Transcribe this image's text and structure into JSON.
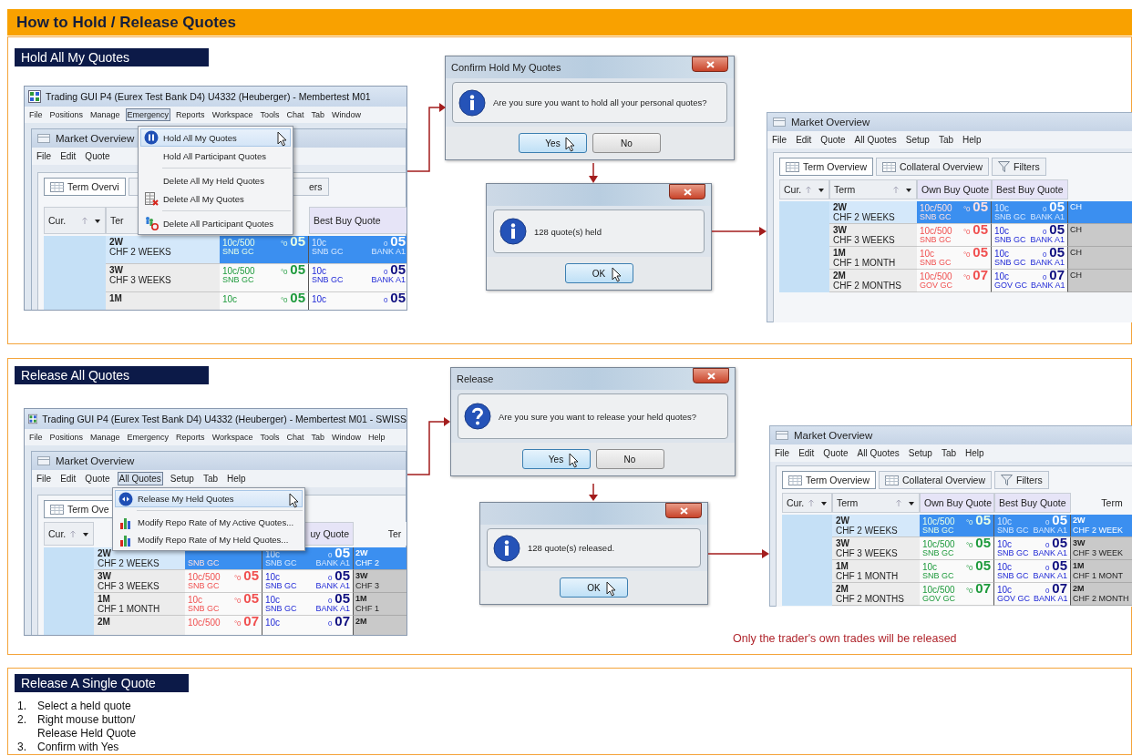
{
  "header": {
    "title": "How to Hold / Release Quotes"
  },
  "sections": [
    {
      "kind": "hold",
      "title": "Hold All My Quotes",
      "app": {
        "title": "Trading GUI P4 (Eurex Test Bank D4) U4332 (Heuberger) - Membertest M01",
        "menu": [
          {
            "label": "File",
            "selected": false
          },
          {
            "label": "Positions",
            "selected": false
          },
          {
            "label": "Manage",
            "selected": false
          },
          {
            "label": "Emergency",
            "selected": true
          },
          {
            "label": "Reports",
            "selected": false
          },
          {
            "label": "Workspace",
            "selected": false
          },
          {
            "label": "Tools",
            "selected": false
          },
          {
            "label": "Chat",
            "selected": false
          },
          {
            "label": "Tab",
            "selected": false
          },
          {
            "label": "Window",
            "selected": false
          }
        ],
        "market": {
          "title": "Market Overview",
          "menu": [
            {
              "label": "File",
              "selected": false
            },
            {
              "label": "Edit",
              "selected": false
            },
            {
              "label": "Quote",
              "selected": false
            }
          ],
          "tabs": [
            {
              "label": "Term Overvi",
              "kind": "view",
              "selected": true
            },
            {
              "label": "ers",
              "kind": "partial",
              "selected": false
            }
          ],
          "header": {
            "cur": "Cur.",
            "term": "Ter",
            "best": "Best Buy Quote"
          },
          "rows": [
            {
              "term": "2W",
              "name": "CHF 2 WEEKS",
              "selected": true,
              "own": {
                "size": "10c/500",
                "source": "SNB GC",
                "mark": "°0",
                "price": "05",
                "held": false
              },
              "best": {
                "size": "10c",
                "source": "SNB GC",
                "mark": "0",
                "price": "05",
                "bank": "BANK A1"
              }
            },
            {
              "term": "3W",
              "name": "CHF 3 WEEKS",
              "selected": false,
              "own": {
                "size": "10c/500",
                "source": "SNB GC",
                "mark": "°0",
                "price": "05",
                "held": false
              },
              "best": {
                "size": "10c",
                "source": "SNB GC",
                "mark": "0",
                "price": "05",
                "bank": "BANK A1"
              }
            },
            {
              "term": "1M",
              "selected": false,
              "own": {
                "size": "10c",
                "mark": "°0",
                "price": "05",
                "held": false
              },
              "best": {
                "size": "10c",
                "mark": "0",
                "price": "05"
              }
            }
          ]
        },
        "popup": {
          "items": [
            {
              "kind": "hold",
              "label": "Hold All My Quotes",
              "selected": true
            },
            {
              "kind": "item",
              "label": "Hold All Participant Quotes",
              "selected": false
            },
            {
              "kind": "separator"
            },
            {
              "kind": "item",
              "label": "Delete All My Held Quotes",
              "selected": false
            },
            {
              "kind": "delete-mine",
              "label": "Delete All My Quotes",
              "selected": false
            },
            {
              "kind": "separator"
            },
            {
              "kind": "delete-participants",
              "label": "Delete All Participant Quotes",
              "selected": false
            }
          ]
        }
      },
      "confirm": {
        "title": "Confirm Hold My Quotes",
        "kind": "info",
        "message": "Are you sure you want to hold all your personal quotes?",
        "buttons": [
          {
            "label": "Yes",
            "selected": true
          },
          {
            "label": "No",
            "selected": false
          }
        ]
      },
      "result": {
        "kind": "info",
        "message": "128 quote(s) held",
        "buttons": [
          {
            "label": "OK",
            "selected": true
          }
        ]
      },
      "market": {
        "title": "Market Overview",
        "menu": [
          {
            "label": "File",
            "selected": false
          },
          {
            "label": "Edit",
            "selected": false
          },
          {
            "label": "Quote",
            "selected": false
          },
          {
            "label": "All Quotes",
            "selected": false
          },
          {
            "label": "Setup",
            "selected": false
          },
          {
            "label": "Tab",
            "selected": false
          },
          {
            "label": "Help",
            "selected": false
          }
        ],
        "tabs": [
          {
            "label": "Term Overview",
            "kind": "view",
            "selected": true
          },
          {
            "label": "Collateral Overview",
            "kind": "view",
            "selected": false
          },
          {
            "label": "Filters",
            "kind": "filter",
            "selected": false
          }
        ],
        "header": {
          "cur": "Cur.",
          "term": "Term",
          "own": "Own Buy Quote",
          "best": "Best Buy Quote"
        },
        "rows": [
          {
            "term": "2W",
            "name": "CHF 2 WEEKS",
            "selected": true,
            "own": {
              "size": "10c/500",
              "source": "SNB GC",
              "mark": "°0",
              "price": "05",
              "held": true
            },
            "best": {
              "size": "10c",
              "source": "SNB GC",
              "mark": "0",
              "price": "05",
              "bank": "BANK A1"
            },
            "extra": {
              "name": "CH"
            }
          },
          {
            "term": "3W",
            "name": "CHF 3 WEEKS",
            "selected": false,
            "own": {
              "size": "10c/500",
              "source": "SNB GC",
              "mark": "°0",
              "price": "05",
              "held": true
            },
            "best": {
              "size": "10c",
              "source": "SNB GC",
              "mark": "0",
              "price": "05",
              "bank": "BANK A1"
            },
            "extra": {
              "name": "CH"
            }
          },
          {
            "term": "1M",
            "name": "CHF 1 MONTH",
            "selected": false,
            "own": {
              "size": "10c",
              "source": "SNB GC",
              "mark": "°0",
              "price": "05",
              "held": true
            },
            "best": {
              "size": "10c",
              "source": "SNB GC",
              "mark": "0",
              "price": "05",
              "bank": "BANK A1"
            },
            "extra": {
              "name": "CH"
            }
          },
          {
            "term": "2M",
            "name": "CHF 2 MONTHS",
            "selected": false,
            "own": {
              "size": "10c/500",
              "source": "GOV GC",
              "mark": "°0",
              "price": "07",
              "held": true
            },
            "best": {
              "size": "10c",
              "source": "GOV GC",
              "mark": "0",
              "price": "07",
              "bank": "BANK A1"
            },
            "extra": {
              "name": "CH"
            }
          }
        ]
      }
    },
    {
      "kind": "release",
      "title": "Release All Quotes",
      "app": {
        "title": "Trading GUI P4 (Eurex Test Bank D4) U4332 (Heuberger) - Membertest M01 - SWISS",
        "menu": [
          {
            "label": "File",
            "selected": false
          },
          {
            "label": "Positions",
            "selected": false
          },
          {
            "label": "Manage",
            "selected": false
          },
          {
            "label": "Emergency",
            "selected": false
          },
          {
            "label": "Reports",
            "selected": false
          },
          {
            "label": "Workspace",
            "selected": false
          },
          {
            "label": "Tools",
            "selected": false
          },
          {
            "label": "Chat",
            "selected": false
          },
          {
            "label": "Tab",
            "selected": false
          },
          {
            "label": "Window",
            "selected": false
          },
          {
            "label": "Help",
            "selected": false
          }
        ],
        "market": {
          "title": "Market Overview",
          "menu": [
            {
              "label": "File",
              "selected": false
            },
            {
              "label": "Edit",
              "selected": false
            },
            {
              "label": "Quote",
              "selected": false
            },
            {
              "label": "All Quotes",
              "selected": true
            },
            {
              "label": "Setup",
              "selected": false
            },
            {
              "label": "Tab",
              "selected": false
            },
            {
              "label": "Help",
              "selected": false
            }
          ],
          "tabs": [
            {
              "label": "Term Ove",
              "kind": "view",
              "selected": true
            }
          ],
          "header": {
            "cur": "Cur.",
            "best": "uy Quote",
            "extra": "Ter"
          },
          "rows": [
            {
              "term": "2W",
              "name": "CHF 2 WEEKS",
              "selected": true,
              "own": {
                "source": "SNB GC",
                "held": true
              },
              "best": {
                "size": "10c",
                "source": "SNB GC",
                "mark": "0",
                "price": "05",
                "bank": "BANK A1"
              },
              "extra": {
                "term": "2W",
                "name": "CHF 2"
              }
            },
            {
              "term": "3W",
              "name": "CHF 3 WEEKS",
              "selected": false,
              "own": {
                "size": "10c/500",
                "source": "SNB GC",
                "mark": "°0",
                "price": "05",
                "held": true
              },
              "best": {
                "size": "10c",
                "source": "SNB GC",
                "mark": "0",
                "price": "05",
                "bank": "BANK A1"
              },
              "extra": {
                "term": "3W",
                "name": "CHF 3"
              }
            },
            {
              "term": "1M",
              "name": "CHF 1 MONTH",
              "selected": false,
              "own": {
                "size": "10c",
                "source": "SNB GC",
                "mark": "°0",
                "price": "05",
                "held": true
              },
              "best": {
                "size": "10c",
                "source": "SNB GC",
                "mark": "0",
                "price": "05",
                "bank": "BANK A1"
              },
              "extra": {
                "term": "1M",
                "name": "CHF 1"
              }
            },
            {
              "term": "2M",
              "selected": false,
              "own": {
                "size": "10c/500",
                "mark": "°0",
                "price": "07",
                "held": true
              },
              "best": {
                "size": "10c",
                "mark": "0",
                "price": "07"
              },
              "extra": {
                "term": "2M"
              }
            }
          ]
        },
        "popup": {
          "items": [
            {
              "kind": "release",
              "label": "Release My Held Quotes",
              "selected": true
            },
            {
              "kind": "separator"
            },
            {
              "kind": "repo-rate",
              "label": "Modify Repo Rate of My Active Quotes...",
              "selected": false
            },
            {
              "kind": "repo-rate",
              "label": "Modify Repo Rate of My Held Quotes...",
              "selected": false
            }
          ]
        }
      },
      "confirm": {
        "title": "Release",
        "kind": "question",
        "message": "Are you sure you want to release your held quotes?",
        "buttons": [
          {
            "label": "Yes",
            "selected": true
          },
          {
            "label": "No",
            "selected": false
          }
        ]
      },
      "result": {
        "kind": "info",
        "message": "128 quote(s) released.",
        "buttons": [
          {
            "label": "OK",
            "selected": true
          }
        ]
      },
      "market": {
        "title": "Market Overview",
        "menu": [
          {
            "label": "File",
            "selected": false
          },
          {
            "label": "Edit",
            "selected": false
          },
          {
            "label": "Quote",
            "selected": false
          },
          {
            "label": "All Quotes",
            "selected": false
          },
          {
            "label": "Setup",
            "selected": false
          },
          {
            "label": "Tab",
            "selected": false
          },
          {
            "label": "Help",
            "selected": false
          }
        ],
        "tabs": [
          {
            "label": "Term Overview",
            "kind": "view",
            "selected": true
          },
          {
            "label": "Collateral Overview",
            "kind": "view",
            "selected": false
          },
          {
            "label": "Filters",
            "kind": "filter",
            "selected": false
          }
        ],
        "header": {
          "cur": "Cur.",
          "term": "Term",
          "own": "Own Buy Quote",
          "best": "Best Buy Quote",
          "extra": "Term"
        },
        "rows": [
          {
            "term": "2W",
            "name": "CHF 2 WEEKS",
            "selected": true,
            "own": {
              "size": "10c/500",
              "source": "SNB GC",
              "mark": "°0",
              "price": "05",
              "held": false
            },
            "best": {
              "size": "10c",
              "source": "SNB GC",
              "mark": "0",
              "price": "05",
              "bank": "BANK A1"
            },
            "extra": {
              "term": "2W",
              "name": "CHF 2 WEEK"
            }
          },
          {
            "term": "3W",
            "name": "CHF 3 WEEKS",
            "selected": false,
            "own": {
              "size": "10c/500",
              "source": "SNB GC",
              "mark": "°0",
              "price": "05",
              "held": false
            },
            "best": {
              "size": "10c",
              "source": "SNB GC",
              "mark": "0",
              "price": "05",
              "bank": "BANK A1"
            },
            "extra": {
              "term": "3W",
              "name": "CHF 3 WEEK"
            }
          },
          {
            "term": "1M",
            "name": "CHF 1 MONTH",
            "selected": false,
            "own": {
              "size": "10c",
              "source": "SNB GC",
              "mark": "°0",
              "price": "05",
              "held": false
            },
            "best": {
              "size": "10c",
              "source": "SNB GC",
              "mark": "0",
              "price": "05",
              "bank": "BANK A1"
            },
            "extra": {
              "term": "1M",
              "name": "CHF 1 MONT"
            }
          },
          {
            "term": "2M",
            "name": "CHF 2 MONTHS",
            "selected": false,
            "own": {
              "size": "10c/500",
              "source": "GOV GC",
              "mark": "°0",
              "price": "07",
              "held": false
            },
            "best": {
              "size": "10c",
              "source": "GOV GC",
              "mark": "0",
              "price": "07",
              "bank": "BANK A1"
            },
            "extra": {
              "term": "2M",
              "name": "CHF 2 MONTH"
            }
          }
        ]
      },
      "note": "Only the trader's own trades will be released"
    }
  ],
  "single": {
    "title": "Release A Single Quote",
    "steps": [
      {
        "number": "1.",
        "text": "Select a held quote"
      },
      {
        "number": "2.",
        "text": "Right mouse button/ Release Held Quote"
      },
      {
        "number": "3.",
        "text": "Confirm with Yes"
      }
    ]
  }
}
